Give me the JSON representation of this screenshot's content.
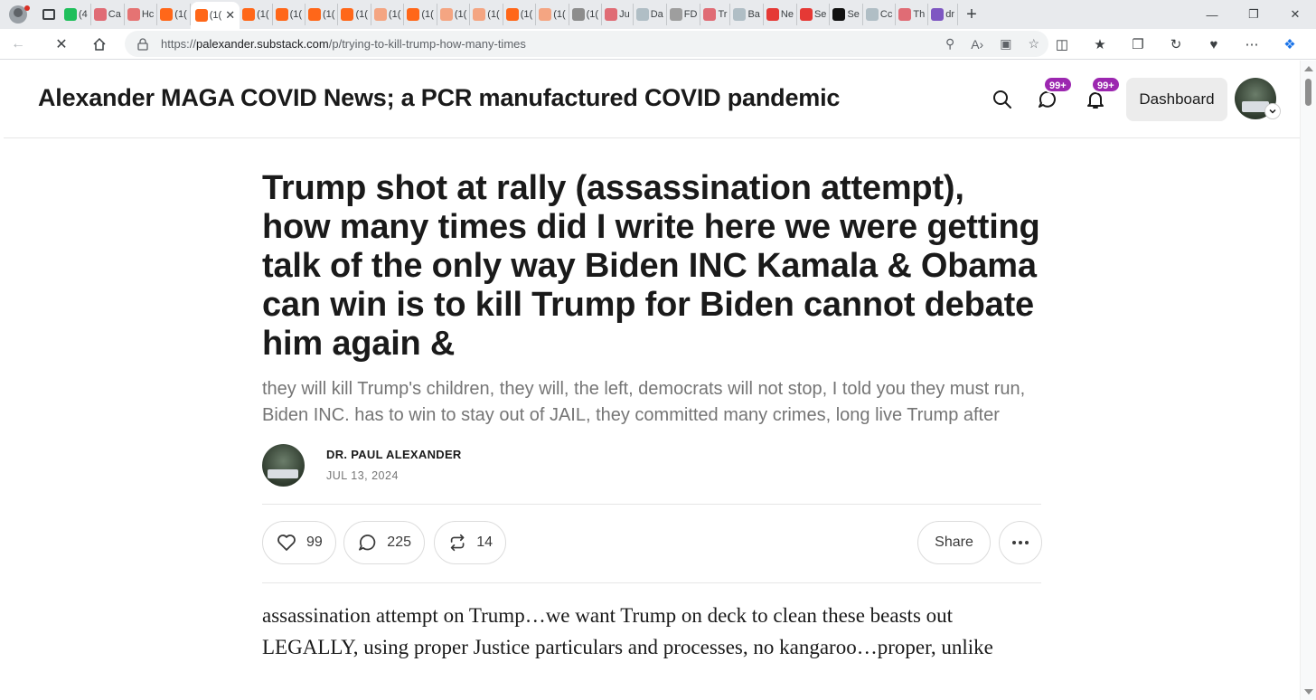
{
  "browser": {
    "tabs": [
      {
        "label": "(4",
        "color": "#1fbf5b"
      },
      {
        "label": "Ca",
        "color": "#e06c75"
      },
      {
        "label": "Hc",
        "color": "#e57373"
      },
      {
        "label": "(1(",
        "color": "#ff6719"
      },
      {
        "label": "(1(",
        "color": "#ff6719",
        "active": true
      },
      {
        "label": "(1(",
        "color": "#ff6719"
      },
      {
        "label": "(1(",
        "color": "#ff6719"
      },
      {
        "label": "(1(",
        "color": "#ff6719"
      },
      {
        "label": "(1(",
        "color": "#ff6719"
      },
      {
        "label": "(1(",
        "color": "#f4a582"
      },
      {
        "label": "(1(",
        "color": "#ff6719"
      },
      {
        "label": "(1(",
        "color": "#f4a582"
      },
      {
        "label": "(1(",
        "color": "#f4a582"
      },
      {
        "label": "(1(",
        "color": "#ff6719"
      },
      {
        "label": "(1(",
        "color": "#f4a582"
      },
      {
        "label": "(1(",
        "color": "#8d8d8d"
      },
      {
        "label": "Ju",
        "color": "#e06c75"
      },
      {
        "label": "Da",
        "color": "#b0bec5"
      },
      {
        "label": "FD",
        "color": "#9e9e9e"
      },
      {
        "label": "Tr",
        "color": "#e06c75"
      },
      {
        "label": "Ba",
        "color": "#b0bec5"
      },
      {
        "label": "Ne",
        "color": "#e53935"
      },
      {
        "label": "Se",
        "color": "#e53935"
      },
      {
        "label": "Se",
        "color": "#111111"
      },
      {
        "label": "Cc",
        "color": "#b0bec5"
      },
      {
        "label": "Th",
        "color": "#e06c75"
      },
      {
        "label": "dr",
        "color": "#7e57c2"
      }
    ],
    "new_tab": "+",
    "url_prefix": "https://",
    "url_host": "palexander.substack.com",
    "url_path": "/p/trying-to-kill-trump-how-many-times"
  },
  "header": {
    "site_title": "Alexander MAGA COVID News; a PCR manufactured COVID pandemic",
    "chat_badge": "99+",
    "notif_badge": "99+",
    "dashboard_label": "Dashboard",
    "accent": "#9c27b0"
  },
  "post": {
    "title": "Trump shot at rally (assassination attempt), how many times did I write here we were getting talk of the only way Biden INC Kamala & Obama can win is to kill Trump for Biden cannot debate him again &",
    "subtitle": "they will kill Trump's children, they will, the left, democrats will not stop, I told you they must run, Biden INC. has to win to stay out of JAIL, they committed many crimes, long live Trump after",
    "author": "DR. PAUL ALEXANDER",
    "date": "JUL 13, 2024",
    "likes": "99",
    "comments": "225",
    "restacks": "14",
    "share_label": "Share",
    "body": "assassination attempt on Trump…we want Trump on deck to clean these beasts out LEGALLY, using proper Justice particulars and processes, no kangaroo…proper, unlike"
  }
}
